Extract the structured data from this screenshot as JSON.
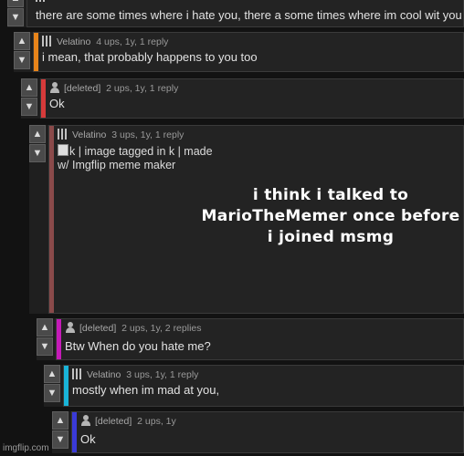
{
  "colors": {
    "page_bg": "#121212",
    "card_bg": "#232323",
    "bar_orange": "#e8841a",
    "bar_red": "#d63a3a",
    "bar_maroon": "#8a4a4a",
    "bar_magenta": "#c51ab8",
    "bar_cyan": "#19b4d8",
    "bar_blue": "#3a3ad8"
  },
  "comments": [
    {
      "text": "there are some times where i hate you, there a some times where im cool wit you",
      "avatar": "checker-avatar-icon"
    },
    {
      "user": "Velatino",
      "stats": "4 ups, 1y, 1 reply",
      "text": "i mean, that probably happens to you too",
      "avatar": "checker-avatar-icon"
    },
    {
      "user": "[deleted]",
      "stats": "2 ups, 1y, 1 reply",
      "text": "Ok",
      "avatar": "person-avatar-icon"
    },
    {
      "user": "Velatino",
      "stats": "3 ups, 1y, 1 reply",
      "image_alt": "k | image tagged in k | made w/ Imgflip meme maker",
      "meme_text": "i think i talked to MarioTheMemer once before i joined msmg",
      "avatar": "checker-avatar-icon"
    },
    {
      "user": "[deleted]",
      "stats": "2 ups, 1y, 2 replies",
      "text": "Btw When do you hate me?",
      "avatar": "person-avatar-icon"
    },
    {
      "user": "Velatino",
      "stats": "3 ups, 1y, 1 reply",
      "text": "mostly when im mad at you,",
      "avatar": "checker-avatar-icon"
    },
    {
      "user": "[deleted]",
      "stats": "2 ups, 1y",
      "text": "Ok",
      "avatar": "person-avatar-icon"
    }
  ],
  "watermark": "imgflip.com",
  "icons": {
    "up": "▲",
    "down": "▼"
  }
}
